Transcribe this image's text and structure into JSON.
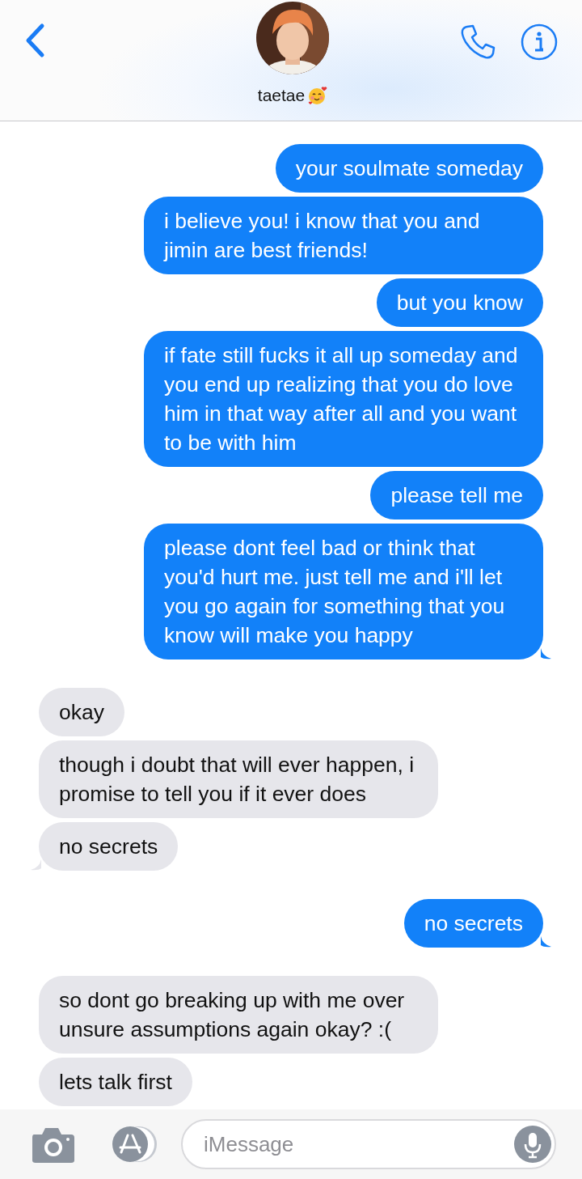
{
  "header": {
    "contact_name": "taetae"
  },
  "messages": [
    {
      "kind": "sent",
      "text": "your soulmate someday",
      "tail": false
    },
    {
      "kind": "sent",
      "text": "i believe you! i know that you and jimin are best friends!",
      "tail": false
    },
    {
      "kind": "sent",
      "text": "but you know",
      "tail": false
    },
    {
      "kind": "sent",
      "text": "if fate still fucks it all up someday and you end up realizing that you do love him in that way after all and you want to be with him",
      "tail": false
    },
    {
      "kind": "sent",
      "text": "please tell me",
      "tail": false
    },
    {
      "kind": "sent",
      "text": "please dont feel bad or think that you'd hurt me. just tell me and i'll let you go again for something that you know will make you happy",
      "tail": true
    },
    {
      "kind": "received",
      "text": "okay",
      "tail": false
    },
    {
      "kind": "received",
      "text": "though i doubt that will ever happen, i promise to tell you if it ever does",
      "tail": false
    },
    {
      "kind": "received",
      "text": "no secrets",
      "tail": true
    },
    {
      "kind": "sent",
      "text": "no secrets",
      "tail": true
    },
    {
      "kind": "received",
      "text": "so dont go breaking up with me over unsure assumptions again okay? :(",
      "tail": false
    },
    {
      "kind": "received",
      "text": "lets talk first",
      "tail": false
    }
  ],
  "composer": {
    "placeholder": "iMessage"
  }
}
